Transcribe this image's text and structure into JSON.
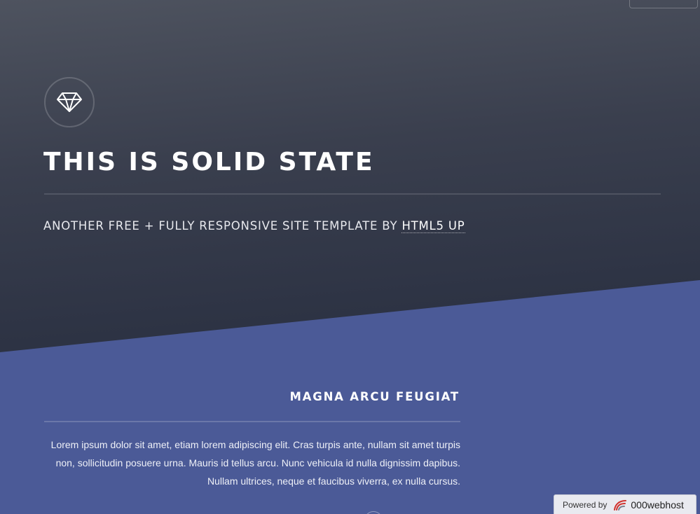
{
  "banner": {
    "title": "THIS IS SOLID STATE",
    "subtitle_prefix": "ANOTHER FREE + FULLY RESPONSIVE SITE TEMPLATE BY ",
    "subtitle_link": "HTML5 UP",
    "logo_icon": "diamond-icon"
  },
  "section": {
    "heading": "MAGNA ARCU FEUGIAT",
    "body": "Lorem ipsum dolor sit amet, etiam lorem adipiscing elit. Cras turpis ante, nullam sit amet turpis non, sollicitudin posuere urna. Mauris id tellus arcu. Nunc vehicula id nulla dignissim dapibus. Nullam ultrices, neque et faucibus viverra, ex nulla cursus."
  },
  "footer_badge": {
    "label": "Powered by",
    "brand": "000webhost",
    "brand_icon": "000webhost-logo-icon"
  },
  "colors": {
    "banner_dark": "#2d3344",
    "section_bg": "#4b5a97",
    "text": "#ffffff"
  }
}
